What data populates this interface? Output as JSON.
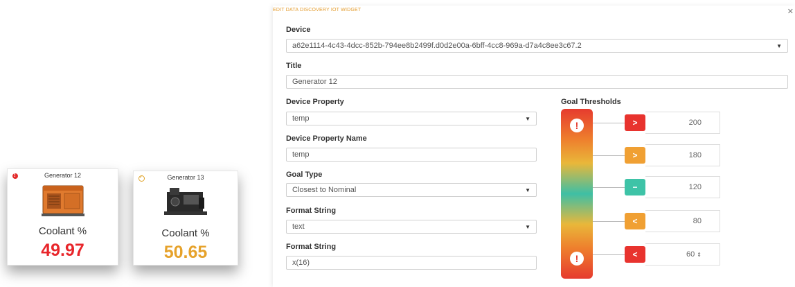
{
  "widgets": [
    {
      "title": "Generator 12",
      "label": "Coolant %",
      "value": "49.97",
      "status_icon": "alert-icon",
      "value_color": "#e8262b"
    },
    {
      "title": "Generator 13",
      "label": "Coolant %",
      "value": "50.65",
      "status_icon": "check-icon",
      "value_color": "#e6a22b"
    }
  ],
  "dialog": {
    "title": "EDIT DATA DISCOVERY IOT WIDGET",
    "close_icon": "close-icon",
    "device": {
      "label": "Device",
      "value": "a62e1114-4c43-4dcc-852b-794ee8b2499f.d0d2e00a-6bff-4cc8-969a-d7a4c8ee3c67.2"
    },
    "title_field": {
      "label": "Title",
      "value": "Generator 12"
    },
    "device_property": {
      "label": "Device Property",
      "value": "temp"
    },
    "device_property_name": {
      "label": "Device Property Name",
      "value": "temp"
    },
    "goal_type": {
      "label": "Goal Type",
      "value": "Closest to Nominal"
    },
    "format_string_1": {
      "label": "Format String",
      "value": "text"
    },
    "format_string_2": {
      "label": "Format String",
      "value": "x(16)"
    },
    "goal_thresholds": {
      "label": "Goal Thresholds",
      "items": [
        {
          "symbol": ">",
          "value": "200",
          "color": "#e8332e"
        },
        {
          "symbol": ">",
          "value": "180",
          "color": "#f0a033"
        },
        {
          "symbol": "−",
          "value": "120",
          "color": "#3ec3a7"
        },
        {
          "symbol": "<",
          "value": "80",
          "color": "#f0a033"
        },
        {
          "symbol": "<",
          "value": "60",
          "color": "#e8332e"
        }
      ]
    }
  }
}
